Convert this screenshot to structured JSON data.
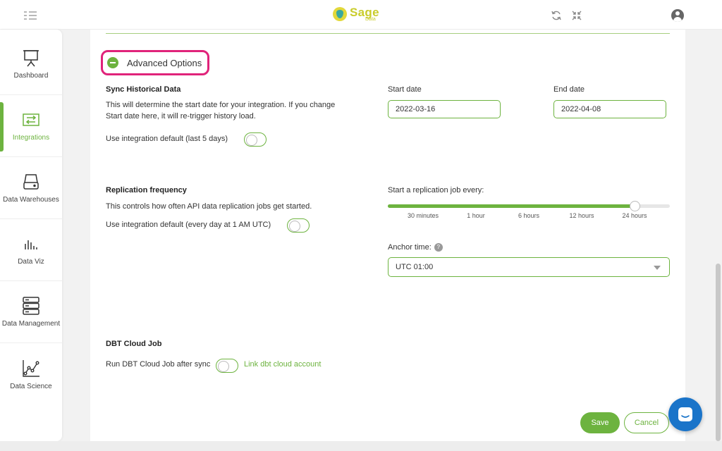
{
  "header": {
    "logo_name": "Sage",
    "logo_sub": "Data",
    "icons": [
      "menu-icon",
      "refresh-icon",
      "collapse-icon",
      "user-icon"
    ]
  },
  "sidebar": {
    "items": [
      {
        "label": "Dashboard",
        "icon": "presentation-icon"
      },
      {
        "label": "Integrations",
        "icon": "exchange-icon",
        "active": true
      },
      {
        "label": "Data Warehouses",
        "icon": "hard-drive-icon"
      },
      {
        "label": "Data Viz",
        "icon": "bar-chart-icon"
      },
      {
        "label": "Data Management",
        "icon": "server-icon"
      },
      {
        "label": "Data Science",
        "icon": "line-chart-icon"
      }
    ]
  },
  "advanced": {
    "label": "Advanced Options"
  },
  "sync": {
    "title": "Sync Historical Data",
    "description_line1": "This will determine the start date for your integration. If you change",
    "description_line2": "Start date here, it will re-trigger history load.",
    "default_label": "Use integration default (last 5 days)",
    "start_label": "Start date",
    "start_value": "2022-03-16",
    "end_label": "End date",
    "end_value": "2022-04-08"
  },
  "replication": {
    "title": "Replication frequency",
    "description": "This controls how often API data replication jobs get started.",
    "default_label": "Use integration default (every day at 1 AM UTC)",
    "slider_label": "Start a replication job every:",
    "ticks": [
      "30 minutes",
      "1 hour",
      "6 hours",
      "12 hours",
      "24 hours"
    ],
    "slider_value_index": 4,
    "anchor_label": "Anchor time:",
    "anchor_help": "?",
    "anchor_value": "UTC 01:00"
  },
  "dbt": {
    "title": "DBT Cloud Job",
    "run_label": "Run DBT Cloud Job after sync",
    "link_label": "Link dbt cloud account"
  },
  "actions": {
    "save_label": "Save",
    "cancel_label": "Cancel"
  },
  "colors": {
    "accent": "#6db33f",
    "highlight": "#e0237a",
    "chat": "#1a74c9"
  }
}
